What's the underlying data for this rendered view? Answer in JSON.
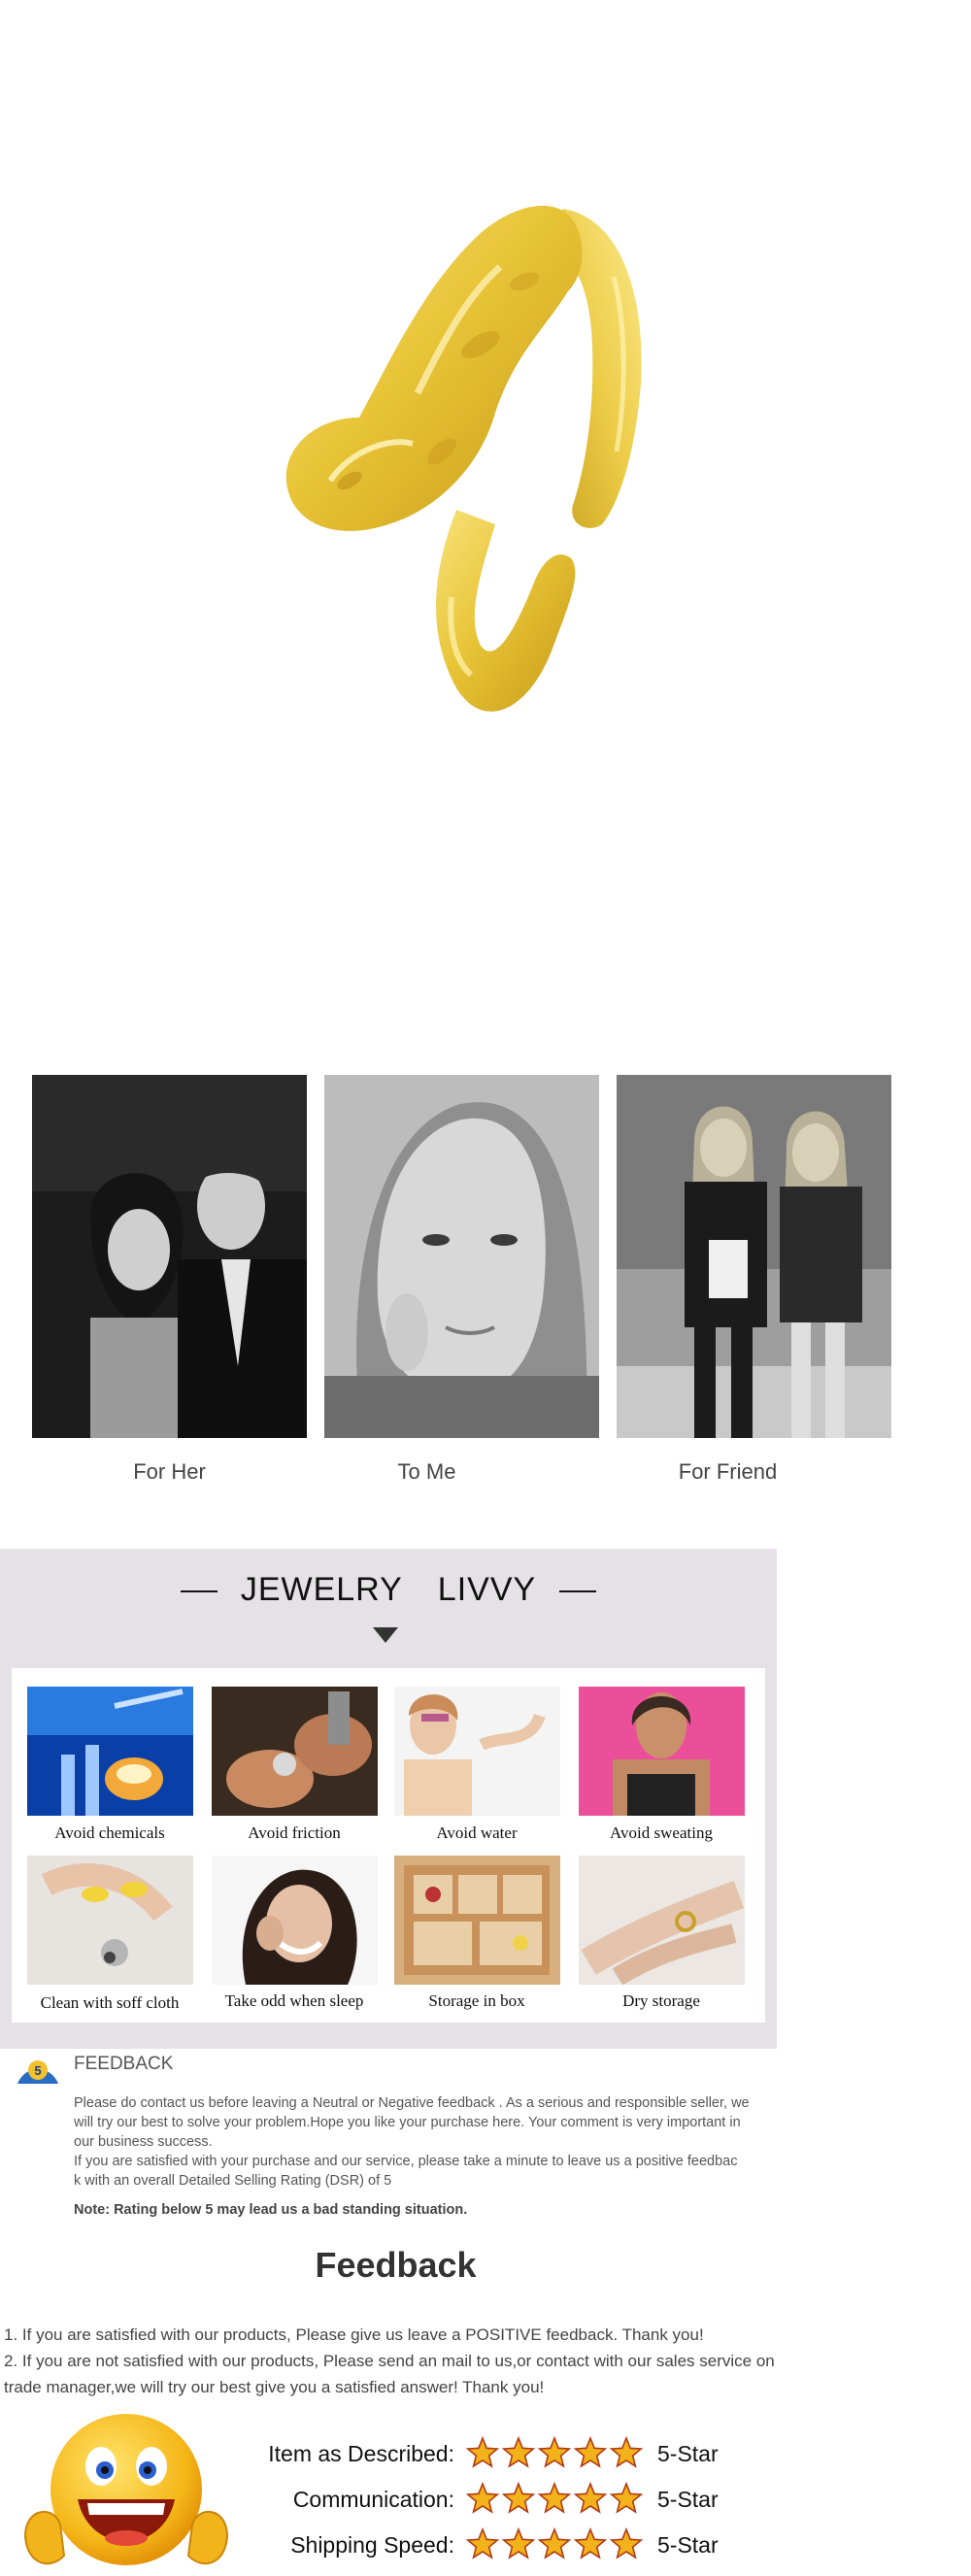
{
  "gift": {
    "captions": [
      "For Her",
      "To Me",
      "For Friend"
    ]
  },
  "care": {
    "brand_left": "JEWELRY",
    "brand_right": "LIVVY",
    "items": [
      "Avoid chemicals",
      "Avoid friction",
      "Avoid water",
      "Avoid sweating",
      "Clean with soff cloth",
      "Take odd when sleep",
      "Storage in box",
      "Dry storage"
    ]
  },
  "feedback_notice": {
    "heading": "FEEDBACK",
    "para1_line1": "Please do contact us before leaving a Neutral or Negative  feedback . As a serious and responsible seller, we",
    "para1_line2": "will try our best to solve your problem.Hope you like your purchase here. Your comment is very important in",
    "para1_line3": "our business success.",
    "para2_line1": " If you are satisfied with your purchase and our service,  please take a minute to leave us  a positive feedbac",
    "para2_line2": "k with an overall  Detailed Selling Rating (DSR) of 5",
    "note": "Note: Rating below 5 may lead us a bad standing situation."
  },
  "feedback": {
    "title": "Feedback",
    "line1": "1. If you are satisfied with our products, Please give us leave a POSITIVE feedback. Thank you!",
    "line2": "2. If you are not satisfied with our products, Please send an mail to us,or contact with our sales service on",
    "line3": "trade manager,we will try our best give you a satisfied answer! Thank you!",
    "ratings": [
      {
        "label": "Item as Described:",
        "stars": 5,
        "value": "5-Star"
      },
      {
        "label": "Communication:",
        "stars": 5,
        "value": "5-Star"
      },
      {
        "label": "Shipping Speed:",
        "stars": 5,
        "value": "5-Star"
      }
    ]
  },
  "colors": {
    "gold": "#e8c53a",
    "panel": "#e5e1e6",
    "star": "#f2b21a"
  }
}
